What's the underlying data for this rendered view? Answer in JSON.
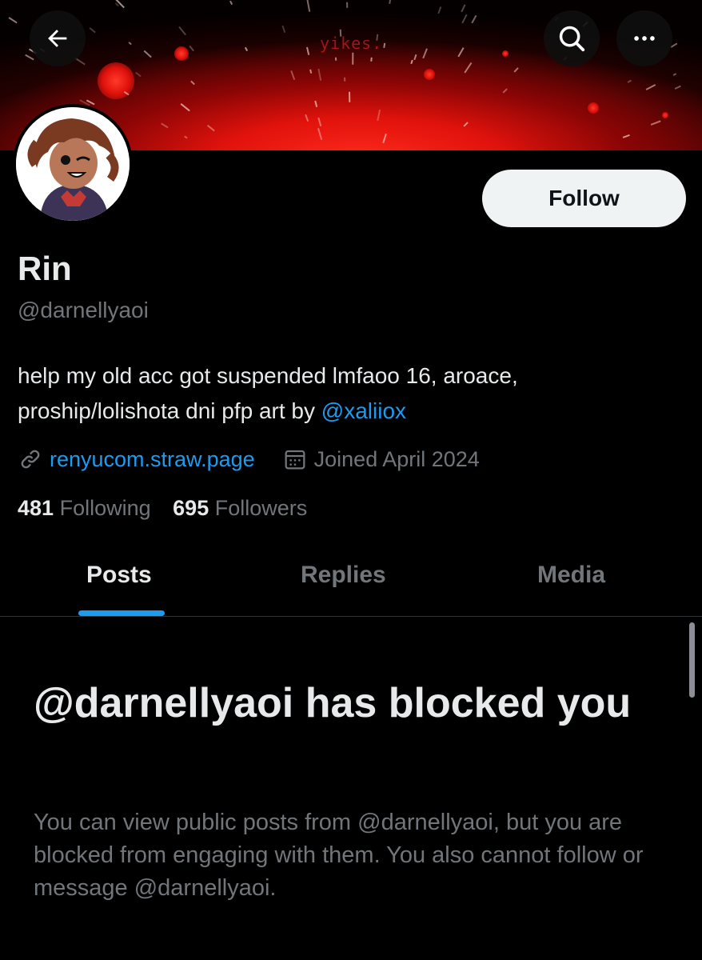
{
  "banner": {
    "text": "yikes."
  },
  "header": {
    "back_icon": "arrow-left-icon",
    "search_icon": "search-icon",
    "more_icon": "more-horizontal-icon"
  },
  "profile": {
    "name": "Rin",
    "handle": "@darnellyaoi",
    "bio_text": "help my old acc got suspended lmfaoo 16, aroace, proship/lolishota dni pfp art by ",
    "bio_mention": "@xaliiox",
    "website": "renyucom.straw.page",
    "joined": "Joined April 2024",
    "following_count": "481",
    "following_label": "Following",
    "followers_count": "695",
    "followers_label": "Followers",
    "follow_label": "Follow"
  },
  "tabs": [
    {
      "label": "Posts",
      "active": true
    },
    {
      "label": "Replies",
      "active": false
    },
    {
      "label": "Media",
      "active": false
    }
  ],
  "blocked": {
    "title": "@darnellyaoi has blocked you",
    "description": "You can view public posts from @darnellyaoi, but you are blocked from engaging with them. You also cannot follow or message @darnellyaoi."
  },
  "colors": {
    "accent": "#1d9bf0",
    "muted": "#71767b",
    "text": "#e7e9ea",
    "banner_red": "#e0120c"
  }
}
